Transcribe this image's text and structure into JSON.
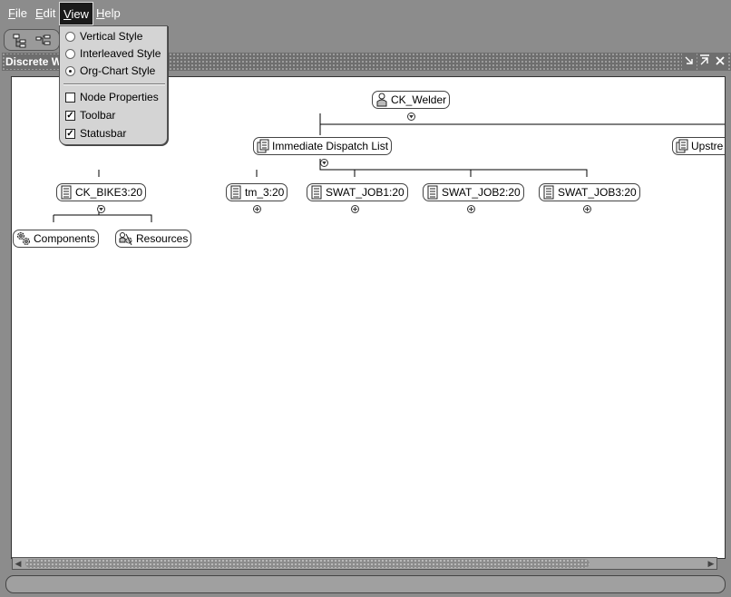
{
  "menubar": {
    "file": {
      "acc": "F",
      "rest": "ile"
    },
    "edit": {
      "acc": "E",
      "rest": "dit"
    },
    "view": {
      "acc": "V",
      "rest": "iew"
    },
    "help": {
      "acc": "H",
      "rest": "elp"
    }
  },
  "view_menu": {
    "items": [
      {
        "label": "Vertical Style",
        "type": "radio",
        "checked": false
      },
      {
        "label": "Interleaved Style",
        "type": "radio",
        "checked": false
      },
      {
        "label": "Org-Chart Style",
        "type": "radio",
        "checked": true
      },
      {
        "label": "Node Properties",
        "type": "check",
        "checked": false
      },
      {
        "label": "Toolbar",
        "type": "check",
        "checked": true
      },
      {
        "label": "Statusbar",
        "type": "check",
        "checked": true
      }
    ]
  },
  "window": {
    "title": "Discrete W"
  },
  "tree": {
    "root": {
      "label": "CK_Welder",
      "icon": "resource-person-icon"
    },
    "dispatch": {
      "label": "Immediate Dispatch List",
      "icon": "dispatch-list-icon"
    },
    "upstream": {
      "label": "Upstre",
      "icon": "upstream-list-icon"
    },
    "jobs": [
      {
        "label": "CK_BIKE3:20",
        "icon": "job-document-icon"
      },
      {
        "label": "tm_3:20",
        "icon": "job-document-icon"
      },
      {
        "label": "SWAT_JOB1:20",
        "icon": "job-document-icon"
      },
      {
        "label": "SWAT_JOB2:20",
        "icon": "job-document-icon"
      },
      {
        "label": "SWAT_JOB3:20",
        "icon": "job-document-icon"
      }
    ],
    "children": [
      {
        "label": "Components",
        "icon": "components-gears-icon"
      },
      {
        "label": "Resources",
        "icon": "resources-icon"
      }
    ]
  }
}
